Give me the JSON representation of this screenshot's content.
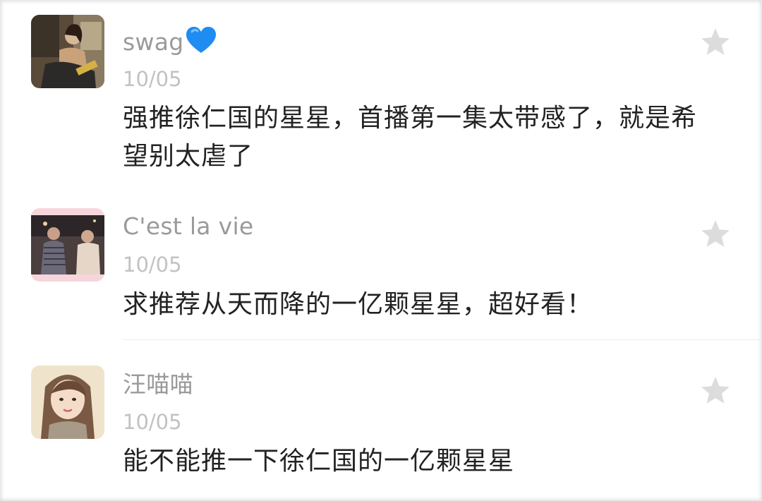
{
  "comments": [
    {
      "username": "swag",
      "username_emoji": "blue-heart-icon",
      "date": "10/05",
      "text": "强推徐仁国的星星，首播第一集太带感了，就是希望别太虐了"
    },
    {
      "username": "C'est la vie",
      "date": "10/05",
      "text": "求推荐从天而降的一亿颗星星，超好看！"
    },
    {
      "username": "汪喵喵",
      "date": "10/05",
      "text": "能不能推一下徐仁国的一亿颗星星"
    }
  ],
  "colors": {
    "username": "#9a9a9a",
    "date": "#c2c2c2",
    "text": "#222222",
    "star": "#dcdcdc",
    "heart": "#1e8cf0"
  },
  "icons": {
    "favorite": "star-icon"
  }
}
